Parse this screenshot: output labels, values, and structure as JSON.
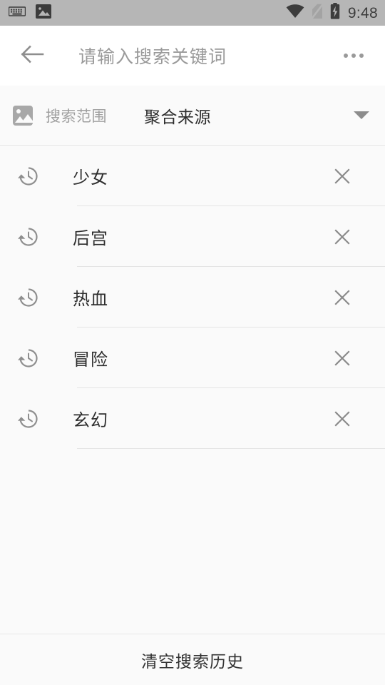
{
  "status_bar": {
    "left_icons": [
      "keyboard-icon",
      "image-icon"
    ],
    "right_icons": [
      "wifi-icon",
      "no-sim-icon",
      "battery-charging-icon"
    ],
    "clock": "9:48",
    "background_color": "#b6b6b6"
  },
  "app_bar": {
    "back_icon": "back-arrow-icon",
    "search_placeholder": "请输入搜索关键词",
    "overflow_icon": "more-vert-icon",
    "background_color": "#ffffff"
  },
  "scope_row": {
    "icon": "image-placeholder-icon",
    "label": "搜索范围",
    "selected_value": "聚合来源",
    "dropdown_icon": "caret-down-icon"
  },
  "history": {
    "items": [
      {
        "label": "少女",
        "icon": "history-icon",
        "delete_icon": "close-icon"
      },
      {
        "label": "后宫",
        "icon": "history-icon",
        "delete_icon": "close-icon"
      },
      {
        "label": "热血",
        "icon": "history-icon",
        "delete_icon": "close-icon"
      },
      {
        "label": "冒险",
        "icon": "history-icon",
        "delete_icon": "close-icon"
      },
      {
        "label": "玄幻",
        "icon": "history-icon",
        "delete_icon": "close-icon"
      }
    ]
  },
  "footer": {
    "clear_label": "清空搜索历史"
  },
  "colors": {
    "page_background": "#fafafa",
    "primary_text": "#2e2e2e",
    "secondary_text": "#9a9a9a",
    "divider": "#e4e4e4"
  }
}
